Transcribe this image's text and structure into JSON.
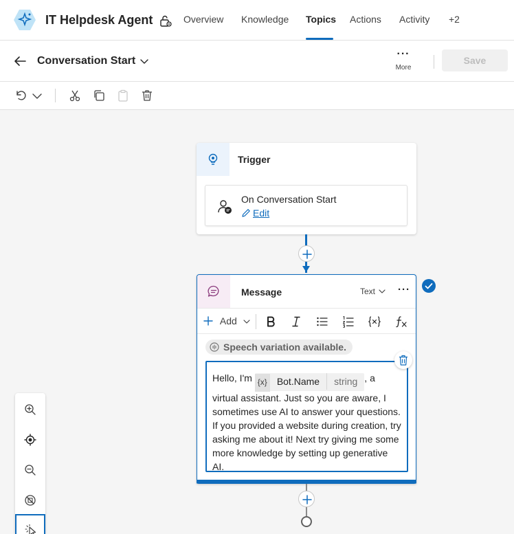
{
  "agent": {
    "name": "IT Helpdesk Agent"
  },
  "nav": {
    "tabs": [
      "Overview",
      "Knowledge",
      "Topics",
      "Actions",
      "Activity",
      "+2"
    ],
    "active_tab": "Topics"
  },
  "topic": {
    "name": "Conversation Start",
    "more_label": "More",
    "more_dots": "···",
    "save_label": "Save"
  },
  "toolbar": {
    "icons": [
      "undo-icon",
      "chevron-down-icon",
      "cut-icon",
      "copy-icon",
      "paste-icon",
      "delete-icon"
    ]
  },
  "canvas": {
    "trigger": {
      "title": "Trigger",
      "event": "On Conversation Start",
      "edit_label": "Edit"
    },
    "message": {
      "title": "Message",
      "type_label": "Text",
      "more_dots": "···",
      "add_label": "Add",
      "format_icons": [
        "bold-icon",
        "italic-icon",
        "bulleted-list-icon",
        "numbered-list-icon",
        "variable-icon",
        "formula-icon"
      ],
      "speech_pill": "Speech variation available.",
      "text_before": "Hello, I'm ",
      "variable": {
        "badge": "{x}",
        "name": "Bot.Name",
        "type": "string"
      },
      "text_after": ", a virtual assistant. Just so you are aware, I sometimes use AI to answer your questions. If you provided a website during creation, try asking me about it! Next try giving me some more knowledge by setting up generative AI."
    }
  },
  "zoom_controls": [
    "zoom-in-icon",
    "recenter-icon",
    "zoom-out-icon",
    "minimap-off-icon",
    "select-icon"
  ],
  "colors": {
    "accent": "#0f6cbd",
    "trigger_icon_bg": "#ebf3fc",
    "message_icon_bg": "#f7ecf5",
    "canvas_bg": "#f5f5f5"
  }
}
